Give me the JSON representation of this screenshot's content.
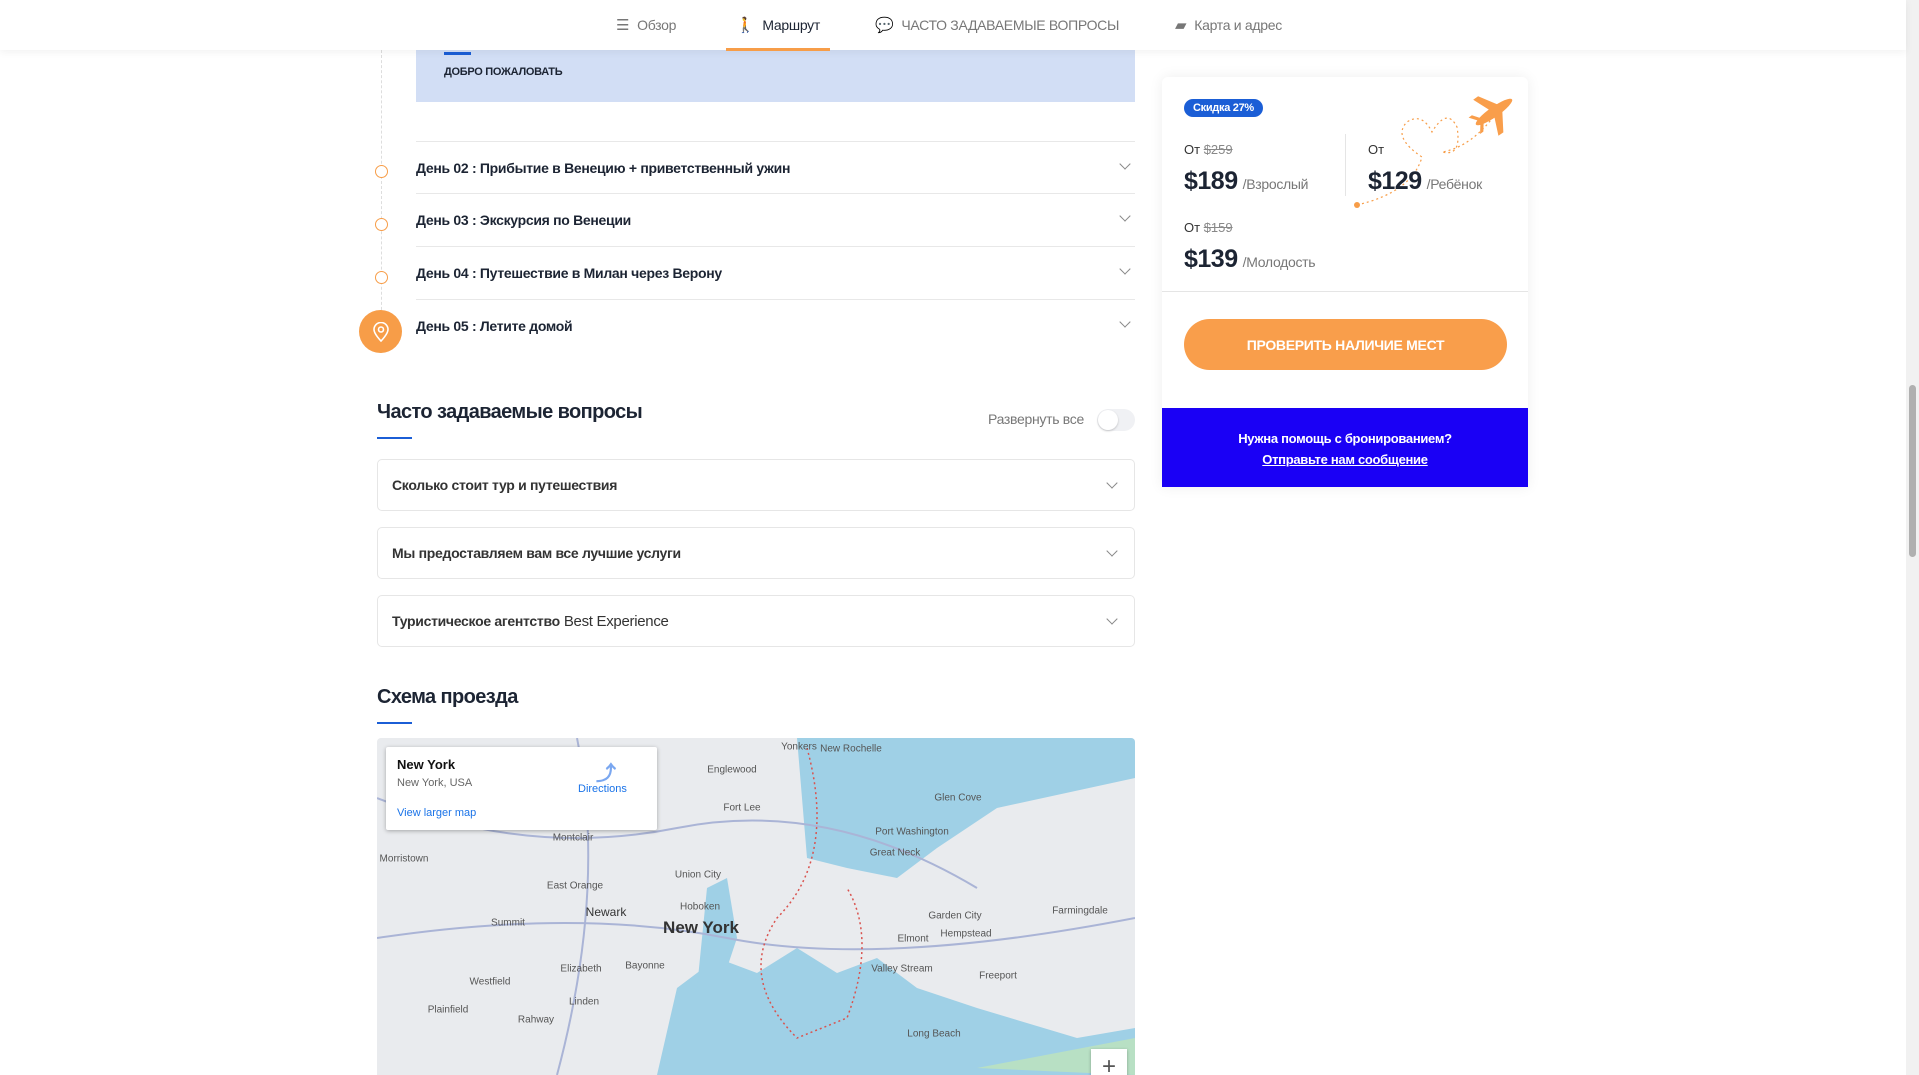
{
  "nav": {
    "items": [
      {
        "label": "Обзор",
        "icon": "list-icon"
      },
      {
        "label": "Маршрут",
        "icon": "hiker-icon",
        "active": true
      },
      {
        "label": "ЧАСТО ЗАДАВАЕМЫЕ ВОПРОСЫ",
        "icon": "chat-icon"
      },
      {
        "label": "Карта и адрес",
        "icon": "map-icon"
      }
    ],
    "accent": "#f79d48"
  },
  "itinerary": {
    "welcome": "ДОБРО ПОЖАЛОВАТЬ",
    "days": [
      {
        "num": "День 02 :",
        "title": "Прибытие в Венецию + приветственный ужин"
      },
      {
        "num": "День 03 :",
        "title": "Экскурсия по Венеции"
      },
      {
        "num": "День 04 :",
        "title": "Путешествие в Милан через Верону"
      },
      {
        "num": "День 05 :",
        "title": "Летите домой"
      }
    ]
  },
  "faq": {
    "title": "Часто задаваемые вопросы",
    "expand_all": "Развернуть все",
    "items": [
      {
        "q": "Сколько стоит тур и путешествия",
        "q2": ""
      },
      {
        "q": "Мы предоставляем вам все лучшие услуги",
        "q2": ""
      },
      {
        "q": "Туристическое агентство",
        "q2": "Best Experience"
      }
    ]
  },
  "map": {
    "title": "Схема проезда",
    "place": "New York",
    "address": "New York, USA",
    "directions": "Directions",
    "view_larger": "View larger map",
    "zoom_in": "+",
    "labels": [
      "Yonkers",
      "New Rochelle",
      "Englewood",
      "Fort Lee",
      "Glen Cove",
      "Port Washington",
      "Great Neck",
      "Montclair",
      "Morristown",
      "Union City",
      "East Orange",
      "Newark",
      "Hoboken",
      "Garden City",
      "Hempstead",
      "Elmont",
      "Summit",
      "Valley Stream",
      "Freeport",
      "Elizabeth",
      "Bayonne",
      "Westfield",
      "Linden",
      "Plainfield",
      "Rahway",
      "Long Beach",
      "Farmingdale",
      "New York"
    ]
  },
  "booking": {
    "discount": "Скидка 27%",
    "from": "От",
    "adult": {
      "old": "$259",
      "price": "$189",
      "unit": "/Взрослый"
    },
    "child": {
      "price": "$129",
      "unit": "/Ребёнок"
    },
    "youth": {
      "old": "$159",
      "price": "$139",
      "unit": "/Молодость"
    },
    "check_button": "ПРОВЕРИТЬ НАЛИЧИЕ МЕСТ",
    "help_text": "Нужна помощь с бронированием?",
    "help_link": "Отправьте нам сообщение",
    "help_bg": "#1a00f5",
    "button_color": "#f99e4b"
  }
}
